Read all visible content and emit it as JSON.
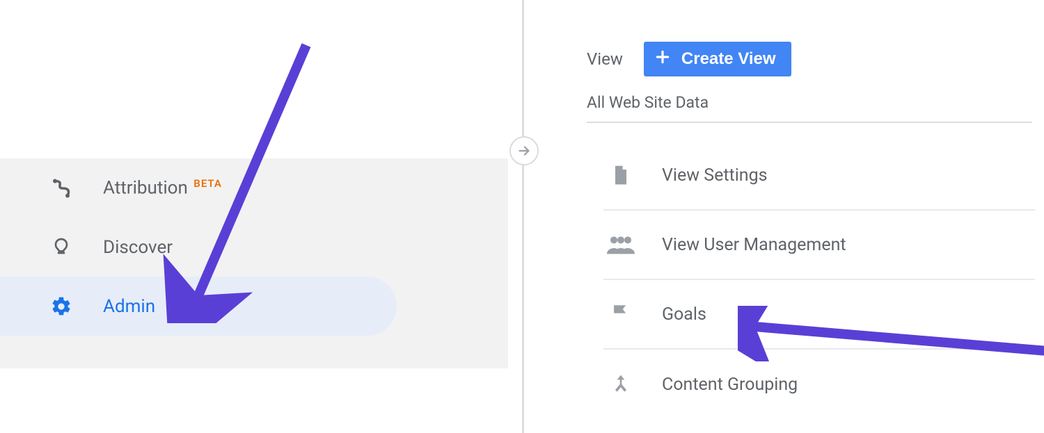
{
  "sidebar": {
    "items": [
      {
        "label": "Attribution",
        "badge": "BETA"
      },
      {
        "label": "Discover"
      },
      {
        "label": "Admin"
      }
    ]
  },
  "view_column": {
    "heading": "View",
    "create_button": "Create View",
    "view_name": "All Web Site Data",
    "items": [
      {
        "label": "View Settings"
      },
      {
        "label": "View User Management"
      },
      {
        "label": "Goals"
      },
      {
        "label": "Content Grouping"
      }
    ]
  }
}
